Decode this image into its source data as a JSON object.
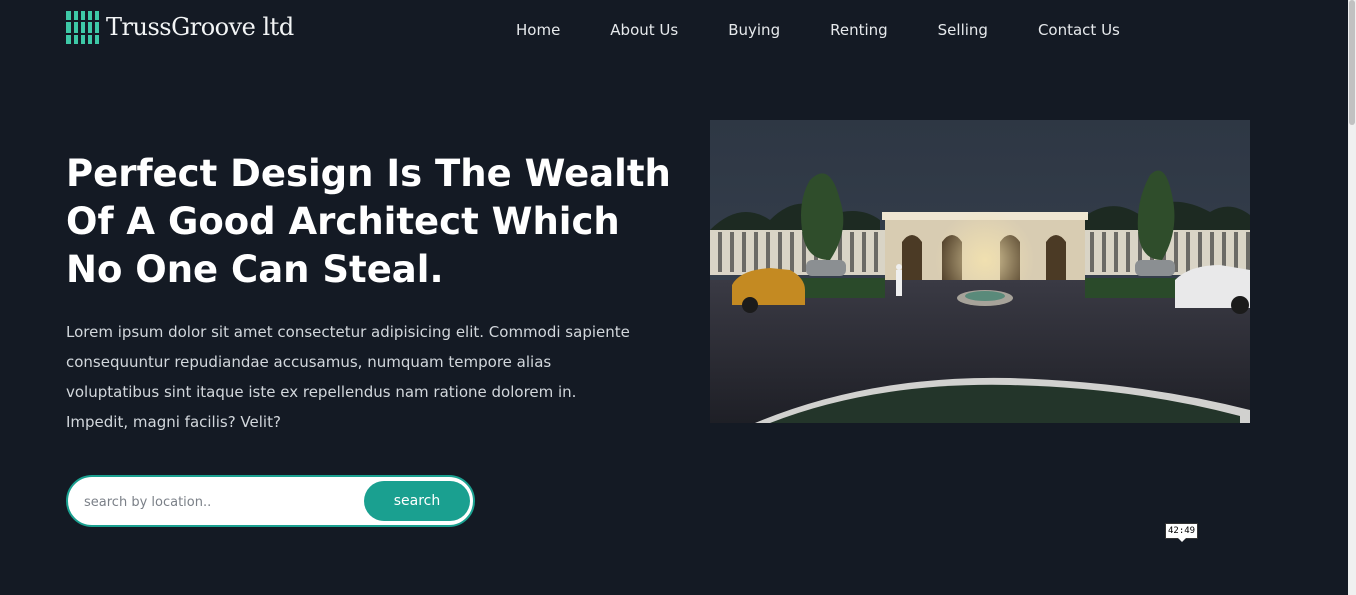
{
  "brand": {
    "name": "TrussGroove ltd",
    "accent": "#1aa090",
    "logo_color": "#3ec9a7"
  },
  "nav": {
    "items": [
      {
        "label": "Home"
      },
      {
        "label": "About Us"
      },
      {
        "label": "Buying"
      },
      {
        "label": "Renting"
      },
      {
        "label": "Selling"
      },
      {
        "label": "Contact Us"
      }
    ]
  },
  "hero": {
    "title": "Perfect Design Is The Wealth Of A Good Architect Which No One Can Steal.",
    "text": "Lorem ipsum dolor sit amet consectetur adipisicing elit. Commodi sapiente consequuntur repudiandae accusamus, numquam tempore alias voluptatibus sint itaque iste ex repellendus nam ratione dolorem in. Impedit, magni facilis? Velit?"
  },
  "search": {
    "placeholder": "search by location..",
    "button_label": "search"
  },
  "image": {
    "alt": "night rendering of a villa entrance with trees and cars"
  },
  "tooltip": {
    "time": "42:49"
  },
  "colors": {
    "background": "#141a24",
    "text": "#ffffff"
  }
}
